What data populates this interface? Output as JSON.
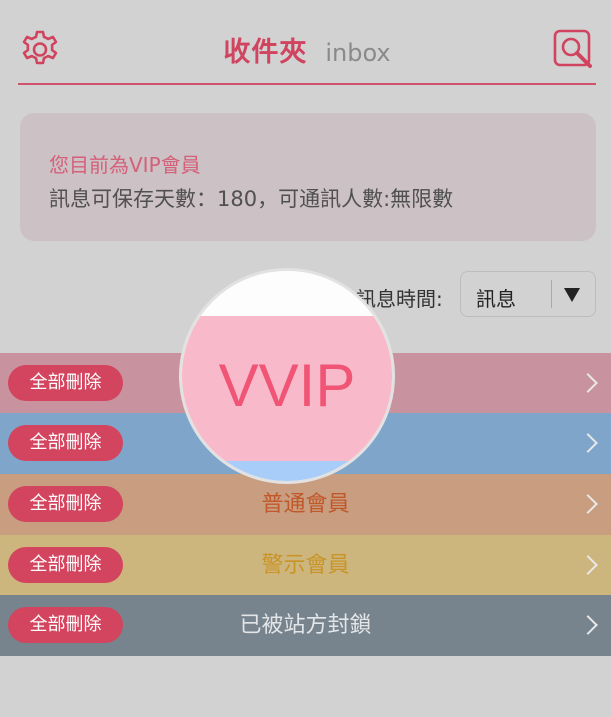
{
  "header": {
    "title": "收件夾",
    "subtitle": "inbox",
    "settings_icon": "gear-icon",
    "search_icon": "search-icon"
  },
  "membership": {
    "status": "您目前為VIP會員",
    "details": "訊息可保存天數：180，可通訊人數:無限數"
  },
  "sort": {
    "label": "訊息時間:",
    "selected": "訊息"
  },
  "rows": [
    {
      "name": "VVIP",
      "delete_label": "全部刪除"
    },
    {
      "name": "",
      "delete_label": "全部刪除"
    },
    {
      "name": "普通會員",
      "delete_label": "全部刪除"
    },
    {
      "name": "警示會員",
      "delete_label": "全部刪除"
    },
    {
      "name": "已被站方封鎖",
      "delete_label": "全部刪除"
    }
  ],
  "magnifier": {
    "text": "VVIP"
  },
  "colors": {
    "accent": "#d0445f",
    "vvip_row": "#c8939e",
    "vip_row": "#7fa5cb",
    "normal_row": "#c99d7f",
    "warning_row": "#cdb67e",
    "blocked_row": "#77838d"
  }
}
